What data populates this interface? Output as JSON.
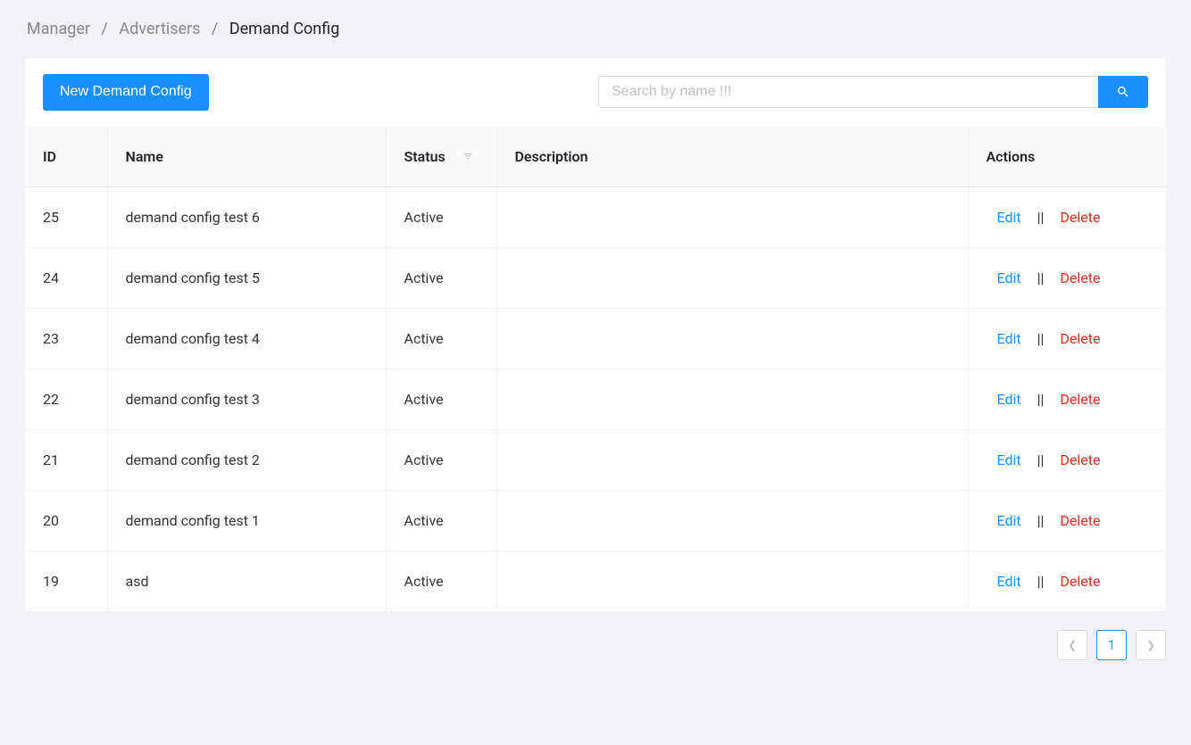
{
  "breadcrumb": {
    "items": [
      "Manager",
      "Advertisers"
    ],
    "current": "Demand Config"
  },
  "toolbar": {
    "new_label": "New Demand Config"
  },
  "search": {
    "placeholder": "Search by name !!!"
  },
  "table": {
    "headers": {
      "id": "ID",
      "name": "Name",
      "status": "Status",
      "description": "Description",
      "actions": "Actions"
    },
    "action_labels": {
      "edit": "Edit",
      "separator": "||",
      "delete": "Delete"
    },
    "rows": [
      {
        "id": "25",
        "name": "demand config test 6",
        "status": "Active",
        "description": ""
      },
      {
        "id": "24",
        "name": "demand config test 5",
        "status": "Active",
        "description": ""
      },
      {
        "id": "23",
        "name": "demand config test 4",
        "status": "Active",
        "description": ""
      },
      {
        "id": "22",
        "name": "demand config test 3",
        "status": "Active",
        "description": ""
      },
      {
        "id": "21",
        "name": "demand config test 2",
        "status": "Active",
        "description": ""
      },
      {
        "id": "20",
        "name": "demand config test 1",
        "status": "Active",
        "description": ""
      },
      {
        "id": "19",
        "name": "asd",
        "status": "Active",
        "description": ""
      }
    ]
  },
  "pagination": {
    "current": "1"
  }
}
